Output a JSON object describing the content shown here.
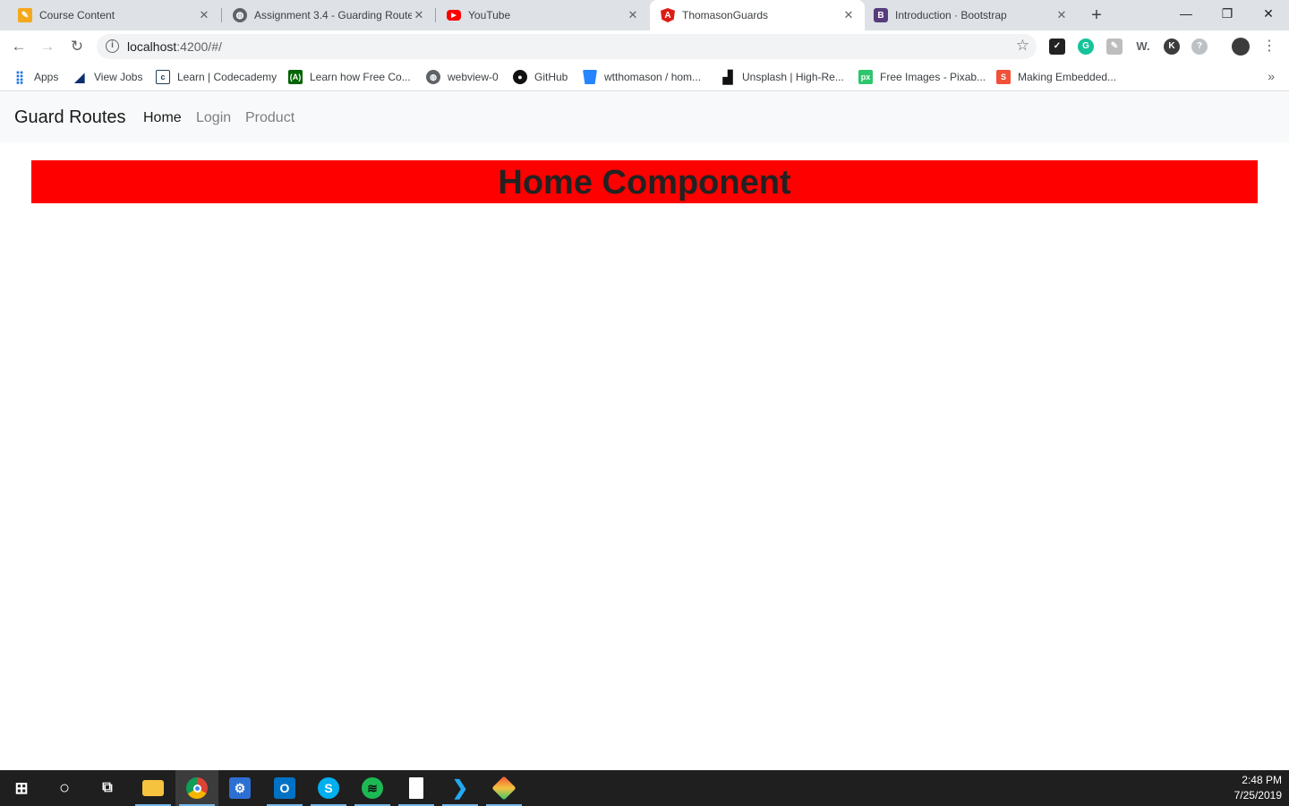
{
  "browser": {
    "tabs": [
      {
        "title": "Course Content",
        "icon": "pencil-icon",
        "color": "#f4a91c",
        "active": false
      },
      {
        "title": "Assignment 3.4 - Guarding Route",
        "icon": "globe-icon",
        "color": "#5f6368",
        "active": false
      },
      {
        "title": "YouTube",
        "icon": "youtube-icon",
        "color": "#ff0000",
        "active": false
      },
      {
        "title": "ThomasonGuards",
        "icon": "angular-icon",
        "color": "#dd1b16",
        "active": true
      },
      {
        "title": "Introduction · Bootstrap",
        "icon": "bootstrap-icon",
        "color": "#563d7c",
        "active": false
      }
    ],
    "url_host": "localhost",
    "url_path": ":4200/#/",
    "bookmarks": [
      {
        "label": "Apps",
        "icon": "apps-grid-icon"
      },
      {
        "label": "View Jobs",
        "icon": "view-jobs-icon"
      },
      {
        "label": "Learn | Codecademy",
        "icon": "codecademy-icon"
      },
      {
        "label": "Learn how Free Co...",
        "icon": "freecodecamp-icon"
      },
      {
        "label": "webview-0",
        "icon": "globe-icon"
      },
      {
        "label": "GitHub",
        "icon": "github-icon"
      },
      {
        "label": "wtthomason / hom...",
        "icon": "bitbucket-icon"
      },
      {
        "label": "Unsplash | High-Re...",
        "icon": "unsplash-icon"
      },
      {
        "label": "Free Images - Pixab...",
        "icon": "pixabay-icon"
      },
      {
        "label": "Making Embedded...",
        "icon": "swift-icon"
      }
    ]
  },
  "app": {
    "brand": "Guard Routes",
    "nav": [
      "Home",
      "Login",
      "Product"
    ],
    "active_nav": "Home",
    "heading": "Home Component",
    "banner_color": "#ff0000"
  },
  "taskbar": {
    "time": "2:48 PM",
    "date": "7/25/2019"
  }
}
